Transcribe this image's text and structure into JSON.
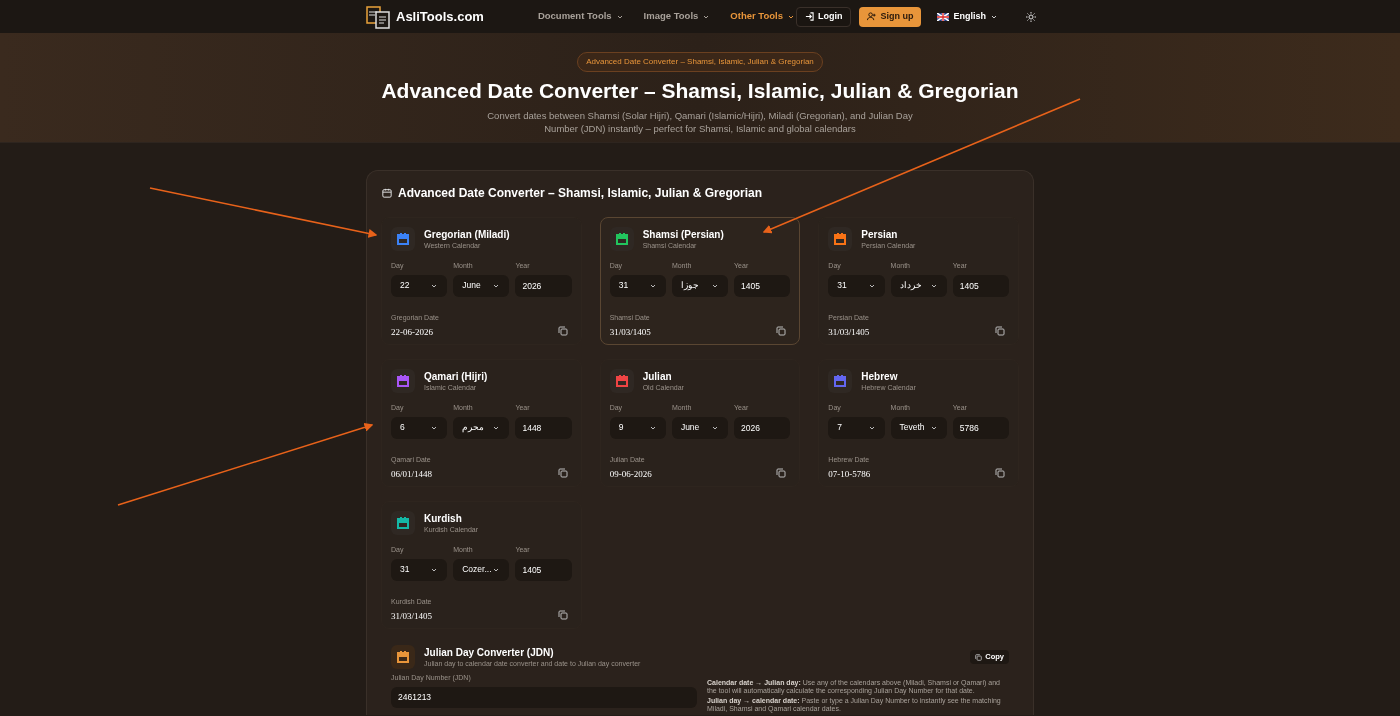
{
  "nav": {
    "logo": "AsliTools.com",
    "menus": [
      {
        "label": "Document Tools",
        "selected": false
      },
      {
        "label": "Image Tools",
        "selected": false
      },
      {
        "label": "Other Tools",
        "selected": true
      }
    ],
    "login": "Login",
    "signup": "Sign up",
    "language": "English"
  },
  "hero": {
    "badge": "Advanced Date Converter – Shamsi, Islamic, Julian & Gregorian",
    "title": "Advanced Date Converter – Shamsi, Islamic, Julian & Gregorian",
    "subtitle": "Convert dates between Shamsi (Solar Hijri), Qamari (Islamic/Hijri), Miladi (Gregorian), and Julian Day Number (JDN) instantly – perfect for Shamsi, Islamic and global calendars"
  },
  "converter": {
    "title": "Advanced Date Converter – Shamsi, Islamic, Julian & Gregorian",
    "calendars": [
      {
        "name": "Gregorian (Miladi)",
        "subtitle": "Western Calendar",
        "color": "#3b82f6",
        "field_labels": [
          "Day",
          "Month",
          "Year"
        ],
        "day": "22",
        "month": "June",
        "year": "2026",
        "date_label": "Gregorian Date",
        "date": "22-06-2026",
        "selected": false
      },
      {
        "name": "Shamsi (Persian)",
        "subtitle": "Shamsi Calendar",
        "color": "#22c55e",
        "field_labels": [
          "Day",
          "Month",
          "Year"
        ],
        "day": "31",
        "month": "جوزا",
        "year": "1405",
        "date_label": "Shamsi Date",
        "date": "31/03/1405",
        "selected": true
      },
      {
        "name": "Persian",
        "subtitle": "Persian Calendar",
        "color": "#f97316",
        "field_labels": [
          "Day",
          "Month",
          "Year"
        ],
        "day": "31",
        "month": "خرداد",
        "year": "1405",
        "date_label": "Persian Date",
        "date": "31/03/1405",
        "selected": false
      },
      {
        "name": "Qamari (Hijri)",
        "subtitle": "Islamic Calendar",
        "color": "#a855f7",
        "field_labels": [
          "Day",
          "Month",
          "Year"
        ],
        "day": "6",
        "month": "محرم",
        "year": "1448",
        "date_label": "Qamari Date",
        "date": "06/01/1448",
        "selected": false
      },
      {
        "name": "Julian",
        "subtitle": "Old Calendar",
        "color": "#ef4444",
        "field_labels": [
          "Day",
          "Month",
          "Year"
        ],
        "day": "9",
        "month": "June",
        "year": "2026",
        "date_label": "Julian Date",
        "date": "09-06-2026",
        "selected": false
      },
      {
        "name": "Hebrew",
        "subtitle": "Hebrew Calendar",
        "color": "#6366f1",
        "field_labels": [
          "Day",
          "Month",
          "Year"
        ],
        "day": "7",
        "month": "Teveth",
        "year": "5786",
        "date_label": "Hebrew Date",
        "date": "07-10-5786",
        "selected": false
      },
      {
        "name": "Kurdish",
        "subtitle": "Kurdish Calendar",
        "color": "#14b8a6",
        "field_labels": [
          "Day",
          "Month",
          "Year"
        ],
        "day": "31",
        "month": "Cozer...",
        "year": "1405",
        "date_label": "Kurdish Date",
        "date": "31/03/1405",
        "selected": false
      }
    ]
  },
  "jdn": {
    "title": "Julian Day Converter (JDN)",
    "subtitle": "Julian day to calendar date converter and date to Julian day converter",
    "copy": "Copy",
    "field_label": "Julian Day Number (JDN)",
    "value": "2461213",
    "notes": [
      "**Calendar date → Julian day:** Use any of the calendars above (Miladi, Shamsi or Qamari) and the tool will automatically calculate the corresponding Julian Day Number for that date.",
      "**Julian day → calendar date:** Paste or type a Julian Day Number to instantly see the matching Miladi, Shamsi and Qamari calendar dates."
    ]
  }
}
